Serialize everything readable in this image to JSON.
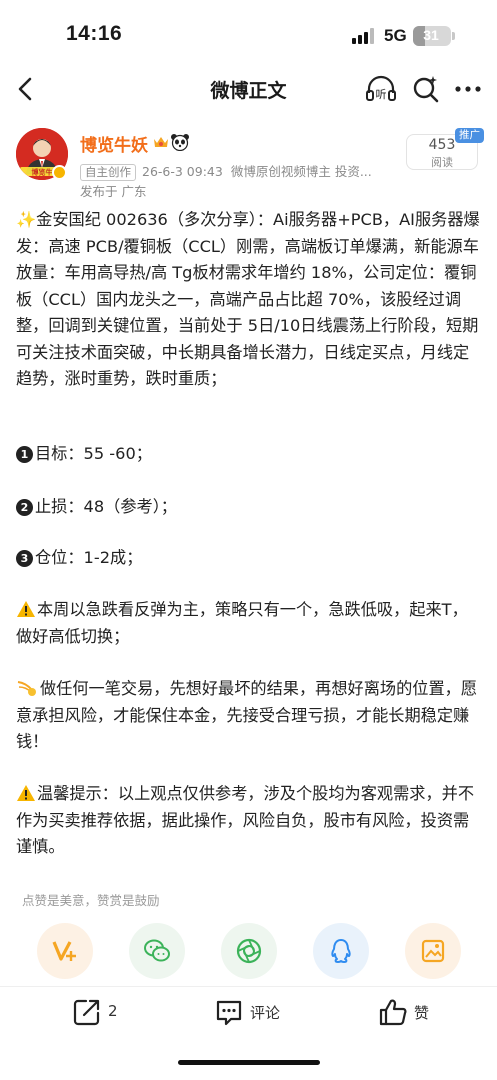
{
  "status_bar": {
    "time": "14:16",
    "network": "5G",
    "battery": "31"
  },
  "nav": {
    "title": "微博正文",
    "icons": [
      "back-icon",
      "listen-icon",
      "search-icon",
      "more-icon"
    ]
  },
  "author": {
    "name": "博览牛妖",
    "tag": "自主创作",
    "date": "26-6-3 09:43",
    "description": "微博原创视频博主 投资...",
    "location": "发布于 广东",
    "read_count": "453",
    "read_label": "阅读",
    "promo": "推广",
    "name_color": "#f26e1a"
  },
  "post": {
    "paragraph1": "金安国纪 002636（多次分享）：Ai服务器+PCB，AI服务器爆发：高速 PCB/覆铜板（CCL）刚需，高端板订单爆满，新能源车放量：车用高导热/高 Tg板材需求年增约 18%，公司定位：覆铜板（CCL）国内龙头之一，高端产品占比超 70%，该股经过调整，回调到关键位置，当前处于 5日/10日线震荡上行阶段，短期可关注技术面突破，中长期具备增长潜力，日线定买点，月线定趋势，涨时重势，跌时重质；",
    "target_num": "1",
    "target": "目标：55 -60；",
    "stop_num": "2",
    "stop": "止损：48（参考）；",
    "position_num": "3",
    "position": "仓位：1-2成；",
    "warning": "本周以急跌看反弹为主，策略只有一个，急跌低吸，起来T，做好高低切换；",
    "trade": "做任何一笔交易，先想好最坏的结果，再想好离场的位置，愿意承担风险，才能保住本金，先接受合理亏损，才能长期稳定赚钱！",
    "tip": "温馨提示：以上观点仅供参考，涉及个股均为客观需求，并不作为买卖推荐依据，据此操作，风险自负，股市有风险，投资需谨慎。"
  },
  "reward": {
    "hint": "点赞是美意，赞赏是鼓励",
    "buttons": [
      "vplus-icon",
      "wechat-icon",
      "aperture-icon",
      "qq-icon",
      "save-image-icon"
    ]
  },
  "bottom_bar": {
    "share_count": "2",
    "comment_label": "评论",
    "like_label": "赞"
  }
}
